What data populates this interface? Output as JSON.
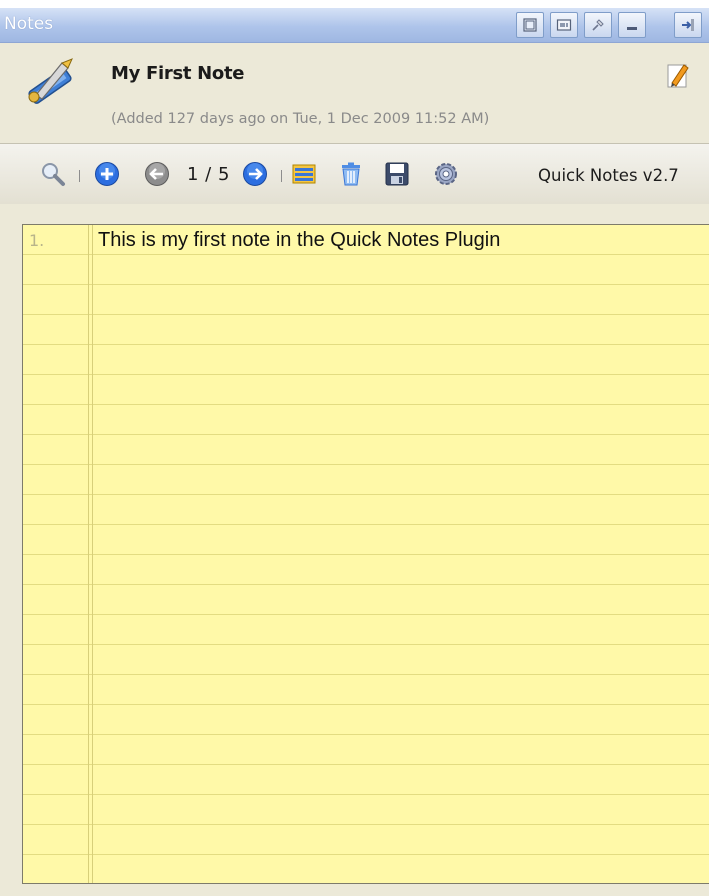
{
  "window": {
    "title": "Notes",
    "controls": [
      "restore-icon",
      "window-icon",
      "pin-icon",
      "minimize-icon",
      "dock-icon"
    ]
  },
  "note": {
    "title": "My First Note",
    "subtitle": "(Added 127 days ago on Tue, 1 Dec 2009 11:52 AM)",
    "icon": "note-tools-icon",
    "edit_icon": "edit-pencil-icon"
  },
  "toolbar": {
    "icons": [
      "search-icon",
      "add-note-icon",
      "previous-icon",
      "next-icon",
      "list-icon",
      "delete-icon",
      "save-icon",
      "settings-icon"
    ],
    "counter": "1 / 5",
    "version": "Quick Notes v2.7"
  },
  "content": {
    "lines": [
      {
        "number": "1.",
        "text": "This is my first note in the Quick Notes Plugin"
      }
    ]
  },
  "colors": {
    "titlebar": "#aec4ea",
    "paper": "#fff9a8",
    "rule_line": "#e3dc82",
    "accent_blue": "#2c6ee0"
  }
}
